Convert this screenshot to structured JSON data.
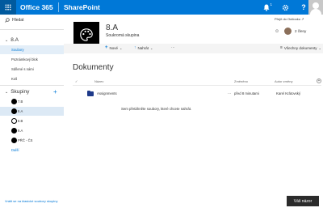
{
  "suite_bar": {
    "brand": "Office 365",
    "product": "SharePoint",
    "notification_count": "1",
    "icons": [
      "waffle-icon",
      "bell-icon",
      "gear-icon",
      "help-icon"
    ],
    "accent_color": "#0078d7",
    "help_label": "?"
  },
  "left_nav": {
    "search_label": "Hledat",
    "site_title": "8.A",
    "items": [
      {
        "label": "Soubory",
        "active": true
      },
      {
        "label": "Poznámkový blok",
        "active": false
      },
      {
        "label": "Sdílené s námi",
        "active": false
      },
      {
        "label": "Koš",
        "active": false
      }
    ],
    "groups_title": "Skupiny",
    "groups_add": "+",
    "groups": [
      {
        "label": "7.B",
        "icon": "palette-icon",
        "active": false
      },
      {
        "label": "8.A",
        "icon": "palette-icon",
        "active": true
      },
      {
        "label": "8.B",
        "icon": "ring-icon",
        "active": false
      },
      {
        "label": "9.A",
        "icon": "group-icon",
        "active": false
      },
      {
        "label": "PŘČ - ČS",
        "icon": "flag-icon",
        "active": false
      }
    ],
    "more_label": "Další",
    "classic_link": "Vrátit se na klasické soubory skupiny"
  },
  "header": {
    "site_name": "8.A",
    "site_subtitle": "Soukromá skupina",
    "outlook_link": "Přejít do Outlooku ↗",
    "member_count": "2 členy"
  },
  "command_bar": {
    "new_label": "Nové",
    "upload_label": "Nahrát",
    "more_label": "···",
    "view_label": "Všechny dokumenty"
  },
  "library": {
    "title": "Dokumenty",
    "columns": {
      "name": "Název",
      "modified": "Změněno",
      "modified_by": "Autor změny"
    },
    "rows": [
      {
        "name": "Assignments",
        "menu": "···",
        "modified": "před 8 minutami",
        "modified_by": "Karel Krátovský"
      }
    ],
    "drop_message": "Sem přetáhněte soubory, které chcete nahrát."
  },
  "feedback_button": "Váš názor"
}
